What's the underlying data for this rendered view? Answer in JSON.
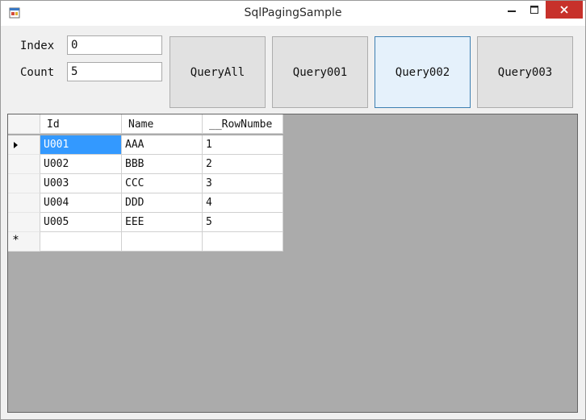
{
  "window": {
    "title": "SqlPagingSample"
  },
  "controls": {
    "minimize_icon": "minimize-icon",
    "maximize_icon": "maximize-icon",
    "close_icon": "close-icon"
  },
  "form": {
    "index_label": "Index",
    "index_value": "0",
    "count_label": "Count",
    "count_value": "5"
  },
  "buttons": {
    "query_all": "QueryAll",
    "query001": "Query001",
    "query002": "Query002",
    "query003": "Query003"
  },
  "grid": {
    "columns": [
      "Id",
      "Name",
      "__RowNumbe"
    ],
    "rows": [
      {
        "id": "U001",
        "name": "AAA",
        "rownum": "1"
      },
      {
        "id": "U002",
        "name": "BBB",
        "rownum": "2"
      },
      {
        "id": "U003",
        "name": "CCC",
        "rownum": "3"
      },
      {
        "id": "U004",
        "name": "DDD",
        "rownum": "4"
      },
      {
        "id": "U005",
        "name": "EEE",
        "rownum": "5"
      }
    ],
    "new_row_marker": "*",
    "selection_color": "#3399ff"
  }
}
